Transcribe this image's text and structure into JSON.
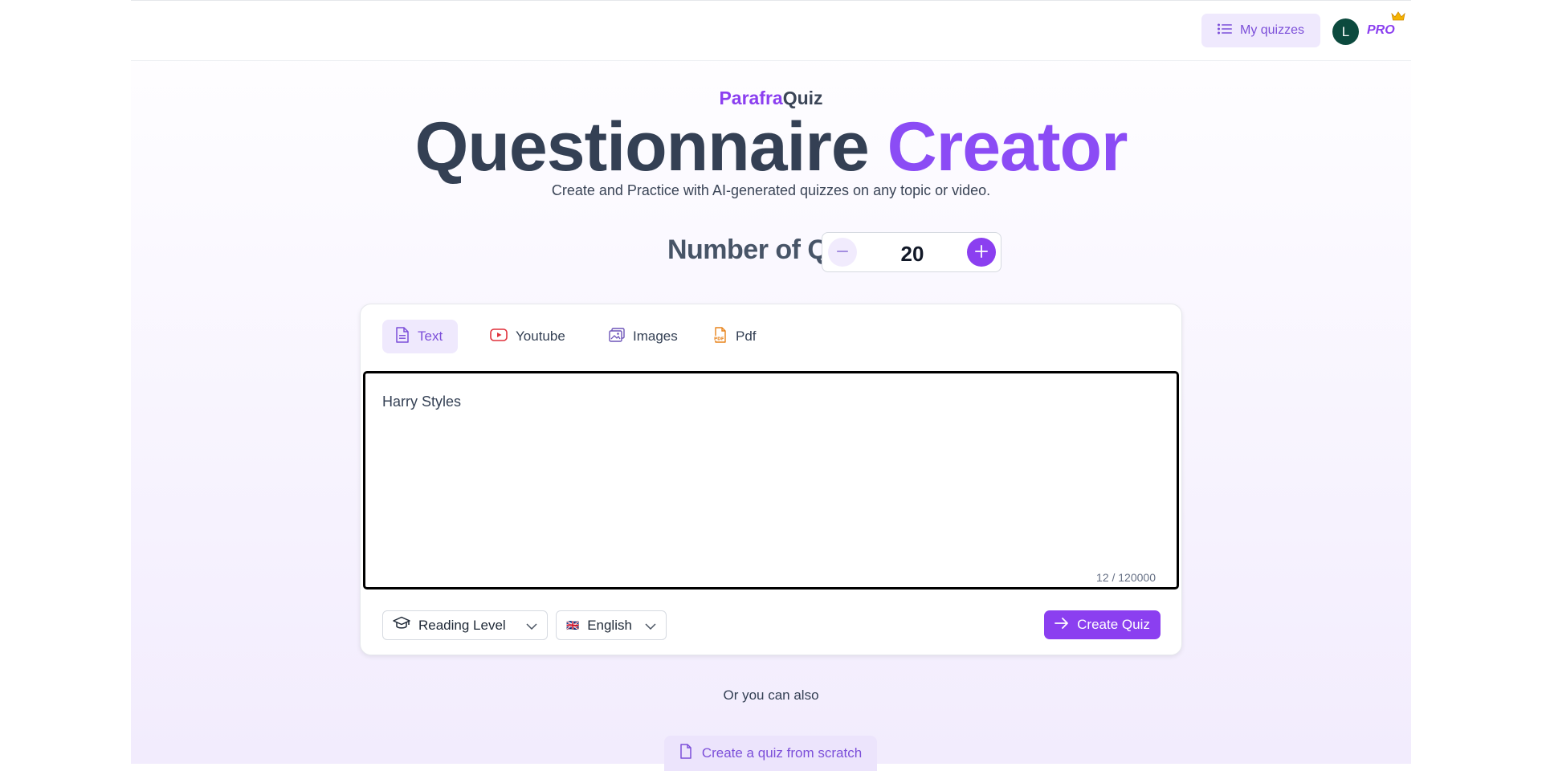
{
  "header": {
    "my_quizzes_label": "My quizzes",
    "avatar_initial": "L",
    "pro_label": "PRO"
  },
  "hero": {
    "brand_part1": "Parafra",
    "brand_part2": "Quiz",
    "title_part1": "Questionnaire",
    "title_part2": "Creator",
    "subtitle": "Create and Practice with AI-generated quizzes on any topic or video."
  },
  "questions": {
    "label": "Number of Questions:",
    "value": "20"
  },
  "tabs": [
    {
      "label": "Text",
      "icon": "document-icon",
      "active": true
    },
    {
      "label": "Youtube",
      "icon": "youtube-icon",
      "active": false
    },
    {
      "label": "Images",
      "icon": "image-icon",
      "active": false
    },
    {
      "label": "Pdf",
      "icon": "pdf-icon",
      "active": false
    }
  ],
  "editor": {
    "value": "Harry Styles",
    "char_count": "12 / 120000"
  },
  "controls": {
    "reading_level_label": "Reading Level",
    "language_flag": "🇬🇧",
    "language_label": "English",
    "create_label": "Create Quiz"
  },
  "footer": {
    "or_text": "Or you can also",
    "scratch_label": "Create a quiz from scratch"
  },
  "colors": {
    "accent": "#8b3ff0",
    "accent_light": "#efe9fd",
    "title_dark": "#344054"
  }
}
